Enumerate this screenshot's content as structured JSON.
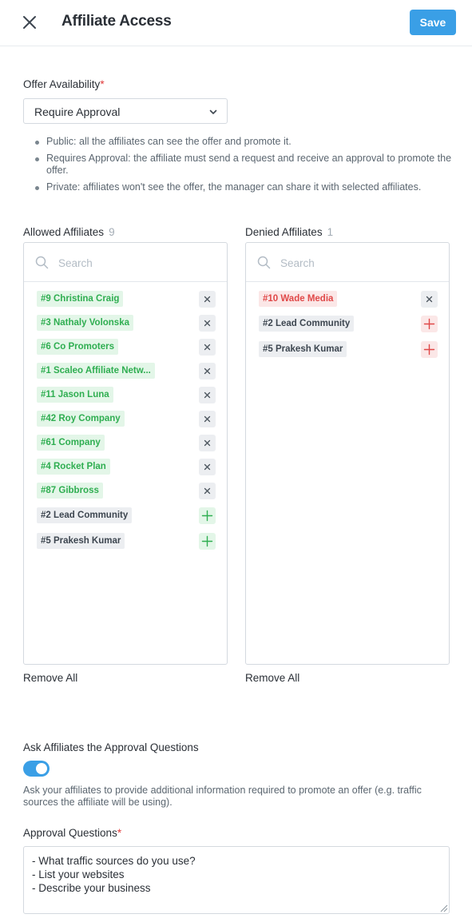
{
  "header": {
    "title": "Affiliate Access",
    "save_label": "Save",
    "close_icon": "close-icon"
  },
  "offer_availability": {
    "label": "Offer Availability",
    "required_mark": "*",
    "selected": "Require Approval",
    "descriptions": [
      "Public: all the affiliates can see the offer and promote it.",
      "Requires Approval: the affiliate must send a request and receive an approval to promote the offer.",
      "Private: affiliates won't see the offer, the manager can share it with selected affiliates."
    ]
  },
  "allowed": {
    "label": "Allowed Affiliates",
    "count": "9",
    "search_placeholder": "Search",
    "items": [
      {
        "label": "#9 Christina Craig",
        "state": "allowed",
        "action": "remove"
      },
      {
        "label": "#3 Nathaly Volonska",
        "state": "allowed",
        "action": "remove"
      },
      {
        "label": "#6 Co Promoters",
        "state": "allowed",
        "action": "remove"
      },
      {
        "label": "#1 Scaleo Affiliate Netw...",
        "state": "allowed",
        "action": "remove"
      },
      {
        "label": "#11 Jason Luna",
        "state": "allowed",
        "action": "remove"
      },
      {
        "label": "#42 Roy Company",
        "state": "allowed",
        "action": "remove"
      },
      {
        "label": "#61 Company",
        "state": "allowed",
        "action": "remove"
      },
      {
        "label": "#4 Rocket Plan",
        "state": "allowed",
        "action": "remove"
      },
      {
        "label": "#87 Gibbross",
        "state": "allowed",
        "action": "remove"
      },
      {
        "label": "#2 Lead Community",
        "state": "neutral",
        "action": "add"
      },
      {
        "label": "#5 Prakesh Kumar",
        "state": "neutral",
        "action": "add"
      }
    ],
    "remove_all_label": "Remove All"
  },
  "denied": {
    "label": "Denied Affiliates",
    "count": "1",
    "search_placeholder": "Search",
    "items": [
      {
        "label": "#10 Wade Media",
        "state": "denied",
        "action": "remove"
      },
      {
        "label": "#2 Lead Community",
        "state": "neutral",
        "action": "add"
      },
      {
        "label": "#5 Prakesh Kumar",
        "state": "neutral",
        "action": "add"
      }
    ],
    "remove_all_label": "Remove All"
  },
  "approval": {
    "toggle_label": "Ask Affiliates the Approval Questions",
    "toggle_on": true,
    "help_text": "Ask your affiliates to provide additional information required to promote an offer (e.g. traffic sources the affiliate will be using).",
    "questions_label": "Approval Questions",
    "required_mark": "*",
    "questions_value": "- What traffic sources do you use?\n- List your websites\n- Describe your business"
  },
  "colors": {
    "accent": "#3a9fe6",
    "allowed_text": "#2fae51",
    "allowed_bg": "#e3f6e8",
    "denied_text": "#e04848",
    "denied_bg": "#fbe7e7",
    "neutral_bg": "#eceef1"
  }
}
